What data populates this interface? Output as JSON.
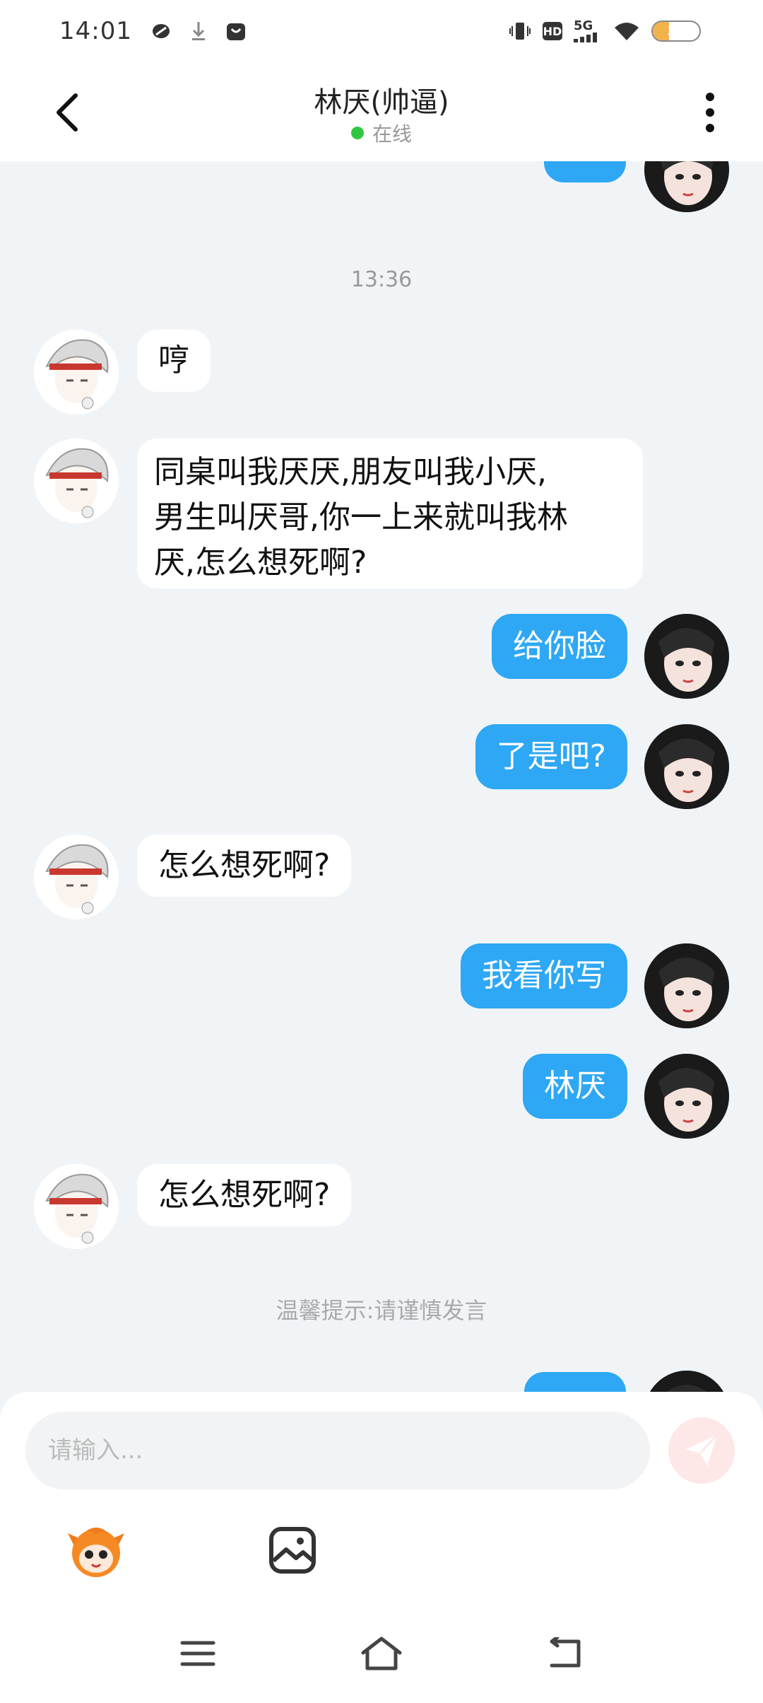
{
  "status_bar": {
    "time": "14:01",
    "network": "5G",
    "hd": "HD",
    "battery": "35",
    "battery_level": 0.35
  },
  "header": {
    "title": "林厌(帅逼)",
    "status": "在线"
  },
  "chat": {
    "timestamp": "13:36",
    "messages": [
      {
        "from": "other",
        "text": "哼"
      },
      {
        "from": "other",
        "lines": [
          "同桌叫我厌厌,朋友叫我小厌,",
          "男生叫厌哥,你一上来就叫我林",
          "厌,怎么想死啊?"
        ]
      },
      {
        "from": "me",
        "text": "给你脸"
      },
      {
        "from": "me",
        "text": "了是吧?"
      },
      {
        "from": "other",
        "text": "怎么想死啊?"
      },
      {
        "from": "me",
        "text": "我看你写"
      },
      {
        "from": "me",
        "text": "林厌"
      },
      {
        "from": "other",
        "text": "怎么想死啊?"
      }
    ],
    "tip": "温馨提示:请谨慎发言"
  },
  "input": {
    "placeholder": "请输入..."
  },
  "icons": {
    "back": "chevron-left-icon",
    "more": "more-vertical-icon",
    "send": "send-icon",
    "emoji": "emoji-mascot-icon",
    "image": "image-icon",
    "nav_menu": "menu-icon",
    "nav_home": "home-icon",
    "nav_back": "back-icon"
  },
  "colors": {
    "accent_bubble": "#2ea7f4",
    "online": "#2fc742",
    "background": "#f1f4f7"
  }
}
